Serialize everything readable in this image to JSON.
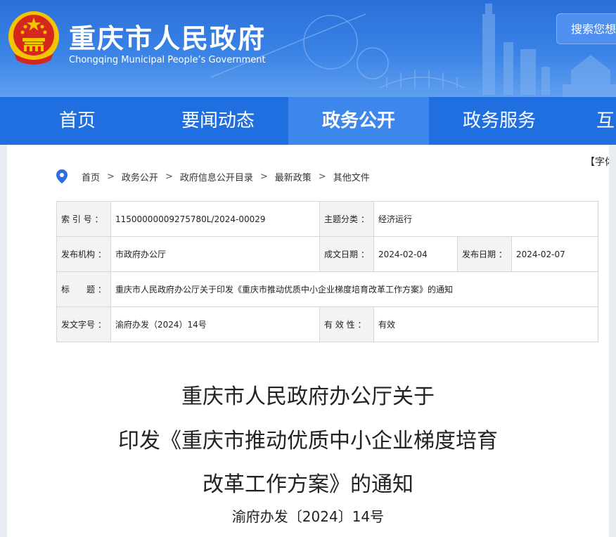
{
  "header": {
    "site_title": "重庆市人民政府",
    "site_subtitle": "Chongqing Municipal People’s Government",
    "search_label": "搜索您想"
  },
  "nav": {
    "items": [
      {
        "label": "首页"
      },
      {
        "label": "要闻动态"
      },
      {
        "label": "政务公开"
      },
      {
        "label": "政务服务"
      },
      {
        "label": "互"
      }
    ],
    "active_index": 2
  },
  "toolbar": {
    "font_size_label": "【字体："
  },
  "breadcrumb": [
    "首页",
    "政务公开",
    "政府信息公开目录",
    "最新政策",
    "其他文件"
  ],
  "meta": {
    "index_label": "索 引 号 ：",
    "index_value": "11500000009275780L/2024-00029",
    "topic_label": "主题分类 ：",
    "topic_value": "经济运行",
    "publisher_label": "发布机构 ：",
    "publisher_value": "市政府办公厅",
    "written_date_label": "成文日期 ：",
    "written_date_value": "2024-02-04",
    "publish_date_label": "发布日期 ：",
    "publish_date_value": "2024-02-07",
    "title_label": "标　　题 ：",
    "title_value": "重庆市人民政府办公厅关于印发《重庆市推动优质中小企业梯度培育改革工作方案》的通知",
    "doc_no_label": "发文字号 ：",
    "doc_no_value": "渝府办发（2024）14号",
    "validity_label": "有 效 性 ：",
    "validity_value": "有效"
  },
  "document": {
    "title_lines": [
      "重庆市人民政府办公厅关于",
      "印发《重庆市推动优质中小企业梯度培育",
      "改革工作方案》的通知"
    ],
    "number": "渝府办发〔2024〕14号"
  },
  "colors": {
    "nav_bg": "#1f6fe0",
    "nav_active": "#3c86ec",
    "header_bg": "#2a6fd9",
    "emblem_red": "#d7261e",
    "emblem_gold": "#f5c400"
  }
}
